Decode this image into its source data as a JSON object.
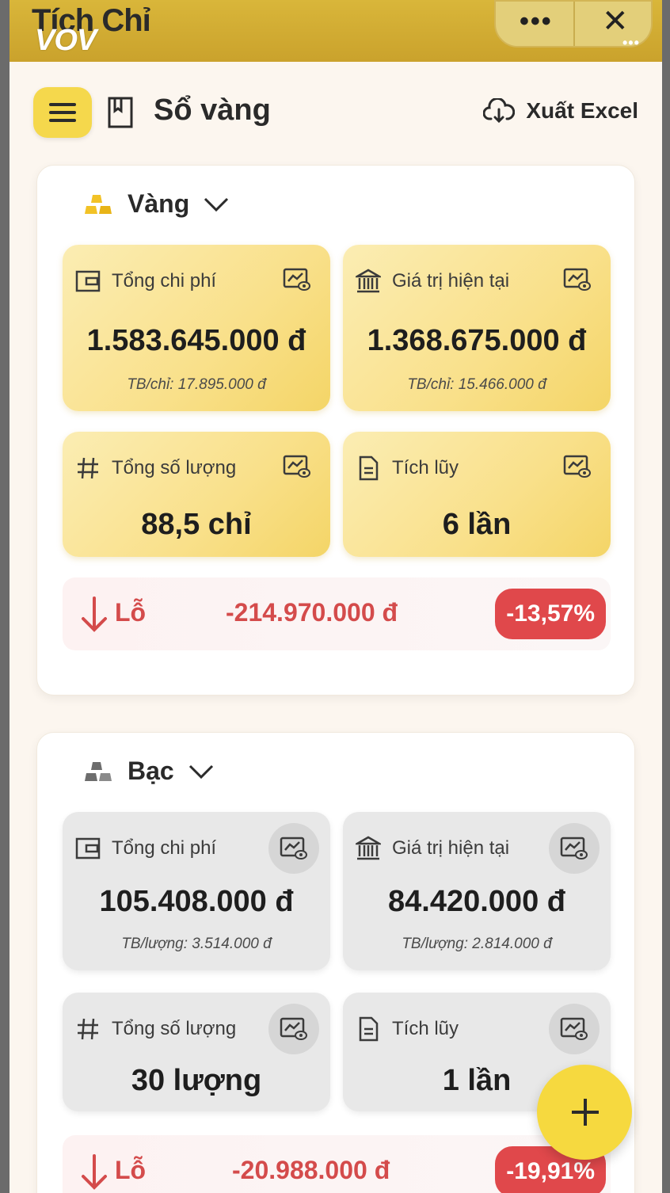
{
  "app": {
    "title": "Tích Chỉ",
    "watermark": "VOV",
    "more_glyph": "•••",
    "close_glyph": "✕",
    "small_dots": "•••"
  },
  "header": {
    "title": "Sổ vàng",
    "export_label": "Xuất Excel",
    "accent": "#f5d84c"
  },
  "sections": {
    "gold": {
      "name": "Vàng",
      "tiles": {
        "total_cost": {
          "label": "Tổng chi phí",
          "value": "1.583.645.000 đ",
          "sub": "TB/chỉ: 17.895.000 đ"
        },
        "current_value": {
          "label": "Giá trị hiện tại",
          "value": "1.368.675.000 đ",
          "sub": "TB/chỉ: 15.466.000 đ"
        },
        "quantity": {
          "label": "Tổng số lượng",
          "value": "88,5 chỉ"
        },
        "accumulate": {
          "label": "Tích lũy",
          "value": "6 lần"
        }
      },
      "loss": {
        "label": "Lỗ",
        "value": "-214.970.000 đ",
        "percent": "-13,57%"
      }
    },
    "silver": {
      "name": "Bạc",
      "tiles": {
        "total_cost": {
          "label": "Tổng chi phí",
          "value": "105.408.000 đ",
          "sub": "TB/lượng: 3.514.000 đ"
        },
        "current_value": {
          "label": "Giá trị hiện tại",
          "value": "84.420.000 đ",
          "sub": "TB/lượng: 2.814.000 đ"
        },
        "quantity": {
          "label": "Tổng số lượng",
          "value": "30 lượng"
        },
        "accumulate": {
          "label": "Tích lũy",
          "value": "1 lần"
        }
      },
      "loss": {
        "label": "Lỗ",
        "value": "-20.988.000 đ",
        "percent": "-19,91%"
      }
    }
  },
  "colors": {
    "loss_red": "#d44b4b",
    "badge_red": "#e0484b",
    "gold_tile": "#f9e08a",
    "silver_tile": "#e8e8e8"
  },
  "icons": [
    "menu-icon",
    "book-icon",
    "cloud-download-icon",
    "gold-bars-icon",
    "silver-bars-icon",
    "chevron-down-icon",
    "wallet-icon",
    "bank-icon",
    "hash-icon",
    "document-icon",
    "chart-eye-icon",
    "arrow-down-icon",
    "plus-icon",
    "close-icon",
    "more-icon"
  ]
}
